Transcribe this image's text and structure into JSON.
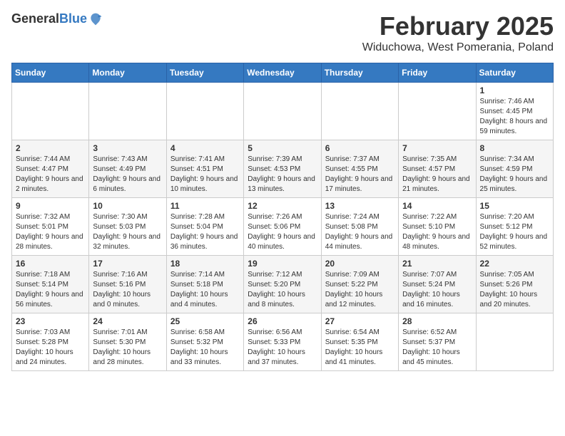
{
  "logo": {
    "general": "General",
    "blue": "Blue"
  },
  "header": {
    "month_title": "February 2025",
    "location": "Widuchowa, West Pomerania, Poland"
  },
  "weekdays": [
    "Sunday",
    "Monday",
    "Tuesday",
    "Wednesday",
    "Thursday",
    "Friday",
    "Saturday"
  ],
  "weeks": [
    [
      {
        "day": "",
        "info": ""
      },
      {
        "day": "",
        "info": ""
      },
      {
        "day": "",
        "info": ""
      },
      {
        "day": "",
        "info": ""
      },
      {
        "day": "",
        "info": ""
      },
      {
        "day": "",
        "info": ""
      },
      {
        "day": "1",
        "info": "Sunrise: 7:46 AM\nSunset: 4:45 PM\nDaylight: 8 hours and 59 minutes."
      }
    ],
    [
      {
        "day": "2",
        "info": "Sunrise: 7:44 AM\nSunset: 4:47 PM\nDaylight: 9 hours and 2 minutes."
      },
      {
        "day": "3",
        "info": "Sunrise: 7:43 AM\nSunset: 4:49 PM\nDaylight: 9 hours and 6 minutes."
      },
      {
        "day": "4",
        "info": "Sunrise: 7:41 AM\nSunset: 4:51 PM\nDaylight: 9 hours and 10 minutes."
      },
      {
        "day": "5",
        "info": "Sunrise: 7:39 AM\nSunset: 4:53 PM\nDaylight: 9 hours and 13 minutes."
      },
      {
        "day": "6",
        "info": "Sunrise: 7:37 AM\nSunset: 4:55 PM\nDaylight: 9 hours and 17 minutes."
      },
      {
        "day": "7",
        "info": "Sunrise: 7:35 AM\nSunset: 4:57 PM\nDaylight: 9 hours and 21 minutes."
      },
      {
        "day": "8",
        "info": "Sunrise: 7:34 AM\nSunset: 4:59 PM\nDaylight: 9 hours and 25 minutes."
      }
    ],
    [
      {
        "day": "9",
        "info": "Sunrise: 7:32 AM\nSunset: 5:01 PM\nDaylight: 9 hours and 28 minutes."
      },
      {
        "day": "10",
        "info": "Sunrise: 7:30 AM\nSunset: 5:03 PM\nDaylight: 9 hours and 32 minutes."
      },
      {
        "day": "11",
        "info": "Sunrise: 7:28 AM\nSunset: 5:04 PM\nDaylight: 9 hours and 36 minutes."
      },
      {
        "day": "12",
        "info": "Sunrise: 7:26 AM\nSunset: 5:06 PM\nDaylight: 9 hours and 40 minutes."
      },
      {
        "day": "13",
        "info": "Sunrise: 7:24 AM\nSunset: 5:08 PM\nDaylight: 9 hours and 44 minutes."
      },
      {
        "day": "14",
        "info": "Sunrise: 7:22 AM\nSunset: 5:10 PM\nDaylight: 9 hours and 48 minutes."
      },
      {
        "day": "15",
        "info": "Sunrise: 7:20 AM\nSunset: 5:12 PM\nDaylight: 9 hours and 52 minutes."
      }
    ],
    [
      {
        "day": "16",
        "info": "Sunrise: 7:18 AM\nSunset: 5:14 PM\nDaylight: 9 hours and 56 minutes."
      },
      {
        "day": "17",
        "info": "Sunrise: 7:16 AM\nSunset: 5:16 PM\nDaylight: 10 hours and 0 minutes."
      },
      {
        "day": "18",
        "info": "Sunrise: 7:14 AM\nSunset: 5:18 PM\nDaylight: 10 hours and 4 minutes."
      },
      {
        "day": "19",
        "info": "Sunrise: 7:12 AM\nSunset: 5:20 PM\nDaylight: 10 hours and 8 minutes."
      },
      {
        "day": "20",
        "info": "Sunrise: 7:09 AM\nSunset: 5:22 PM\nDaylight: 10 hours and 12 minutes."
      },
      {
        "day": "21",
        "info": "Sunrise: 7:07 AM\nSunset: 5:24 PM\nDaylight: 10 hours and 16 minutes."
      },
      {
        "day": "22",
        "info": "Sunrise: 7:05 AM\nSunset: 5:26 PM\nDaylight: 10 hours and 20 minutes."
      }
    ],
    [
      {
        "day": "23",
        "info": "Sunrise: 7:03 AM\nSunset: 5:28 PM\nDaylight: 10 hours and 24 minutes."
      },
      {
        "day": "24",
        "info": "Sunrise: 7:01 AM\nSunset: 5:30 PM\nDaylight: 10 hours and 28 minutes."
      },
      {
        "day": "25",
        "info": "Sunrise: 6:58 AM\nSunset: 5:32 PM\nDaylight: 10 hours and 33 minutes."
      },
      {
        "day": "26",
        "info": "Sunrise: 6:56 AM\nSunset: 5:33 PM\nDaylight: 10 hours and 37 minutes."
      },
      {
        "day": "27",
        "info": "Sunrise: 6:54 AM\nSunset: 5:35 PM\nDaylight: 10 hours and 41 minutes."
      },
      {
        "day": "28",
        "info": "Sunrise: 6:52 AM\nSunset: 5:37 PM\nDaylight: 10 hours and 45 minutes."
      },
      {
        "day": "",
        "info": ""
      }
    ]
  ]
}
